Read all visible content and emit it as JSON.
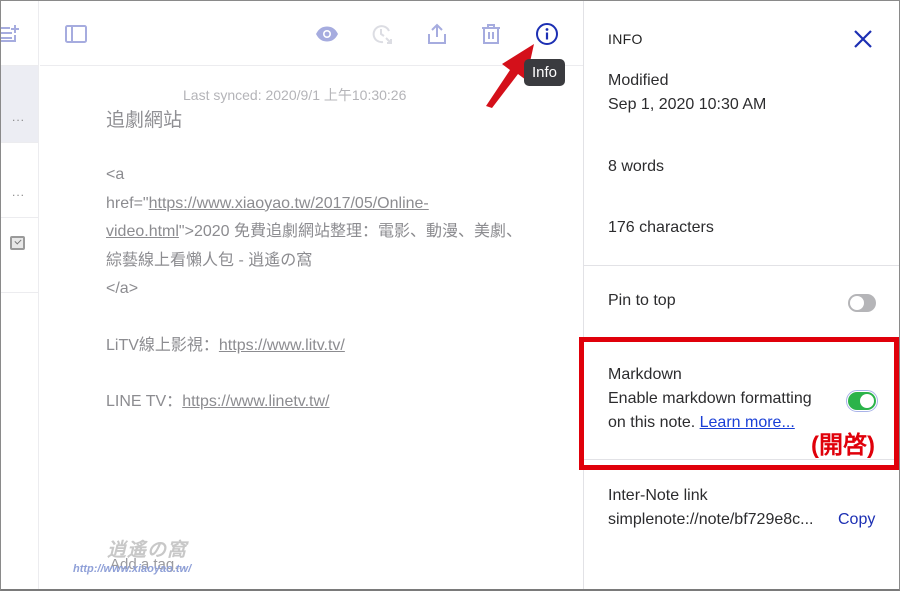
{
  "toolbar": {
    "icons": {
      "sidebar_toggle": "sidebar-toggle-icon",
      "preview": "eye-icon",
      "history": "history-icon",
      "share": "share-icon",
      "trash": "trash-icon",
      "info": "info-icon"
    },
    "tooltip": "Info"
  },
  "editor": {
    "last_synced": "Last synced: 2020/9/1 上午10:30:26",
    "note_title": "追劇網站",
    "lines": {
      "tag_open": "<a",
      "href_prefix": "href=\"",
      "href_link_part1": "https://www.xiaoyao.tw/2017/05/Online-",
      "href_link_part2": "video.html",
      "link_text": "\">2020 免費追劇網站整理：電影、動漫、美劇、綜藝線上看懶人包 - 逍遙の窩",
      "tag_close": "</a>",
      "litv_label": "LiTV線上影視：",
      "litv_url": "https://www.litv.tv/",
      "linetv_label": "LINE TV：",
      "linetv_url": "https://www.linetv.tw/"
    },
    "add_tag_placeholder": "Add a tag...",
    "watermark_text": "逍遙の窩",
    "watermark_url": "http://www.xiaoyao.tw/"
  },
  "note_list": {
    "ellipsis": "..."
  },
  "info_panel": {
    "title": "INFO",
    "modified_label": "Modified",
    "modified_value": "Sep 1, 2020 10:30 AM",
    "words": "8 words",
    "characters": "176 characters",
    "pin_label": "Pin to top",
    "pin_enabled": false,
    "markdown_label": "Markdown",
    "markdown_desc": "Enable markdown formatting",
    "markdown_desc2": "on this note. ",
    "learn_more": "Learn more...",
    "markdown_enabled": true,
    "internote_label": "Inter-Note link",
    "internote_value": "simplenote://note/bf729e8c...",
    "copy_label": "Copy"
  },
  "annotation": {
    "label": "(開啓)",
    "color": "#e0000a"
  },
  "colors": {
    "accent": "#1c2fb3",
    "icon_muted": "#a6acdf",
    "toggle_on": "#2bb34a",
    "toggle_off": "#b5b5b8"
  }
}
